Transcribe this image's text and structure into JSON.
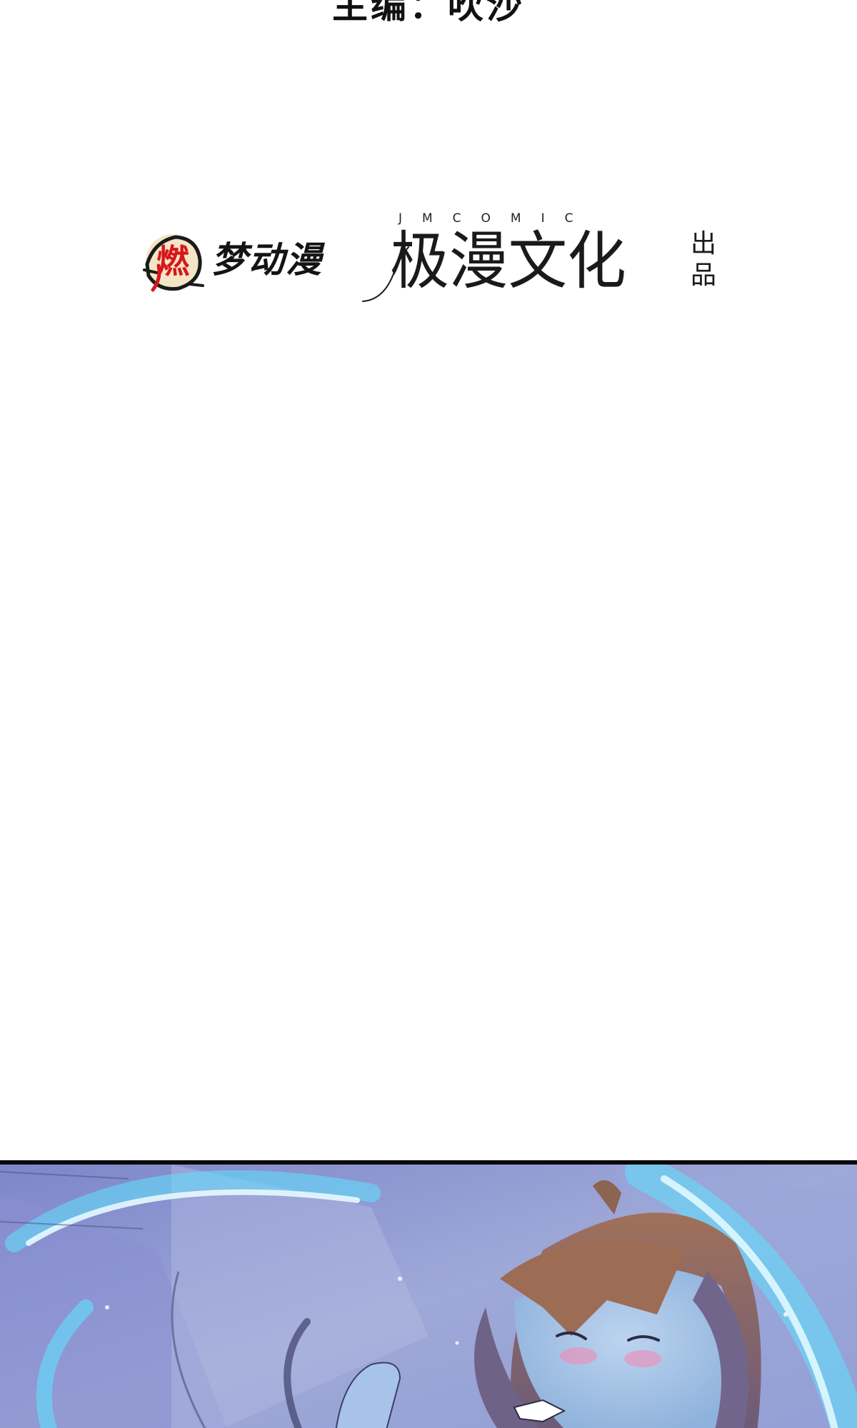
{
  "credits": {
    "editor_line": "主编：吹沙"
  },
  "logos": {
    "ranmeng": {
      "seal_char": "燃",
      "brand": "梦动漫"
    },
    "jimanhua": {
      "latin": "JMCOMIC",
      "chinese": "极漫文化"
    },
    "produced_by": "出品"
  },
  "colors": {
    "page_background": "#ffffff",
    "seal_red": "#d8161b",
    "panel_border": "#0a0a0a",
    "panel_glow": "#5fe1ff"
  }
}
